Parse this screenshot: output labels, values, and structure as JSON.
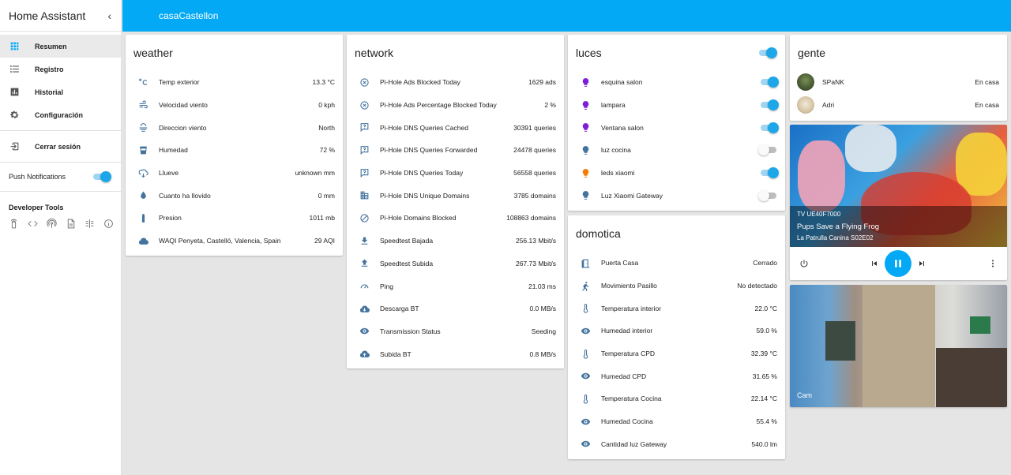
{
  "sidebar": {
    "title": "Home Assistant",
    "items": [
      {
        "label": "Resumen",
        "icon": "apps-icon"
      },
      {
        "label": "Registro",
        "icon": "list-icon"
      },
      {
        "label": "Historial",
        "icon": "chart-icon"
      },
      {
        "label": "Configuración",
        "icon": "gear-icon"
      }
    ],
    "logout": "Cerrar sesión",
    "push": "Push Notifications",
    "dev_tools": "Developer Tools"
  },
  "header": {
    "title": "casaCastellon"
  },
  "weather": {
    "title": "weather",
    "rows": [
      {
        "name": "Temp exterior",
        "value": "13.3 °C"
      },
      {
        "name": "Velocidad viento",
        "value": "0 kph"
      },
      {
        "name": "Direccion viento",
        "value": "North"
      },
      {
        "name": "Humedad",
        "value": "72 %"
      },
      {
        "name": "Llueve",
        "value": "unknown mm"
      },
      {
        "name": "Cuanto ha llovido",
        "value": "0 mm"
      },
      {
        "name": "Presion",
        "value": "1011 mb"
      },
      {
        "name": "WAQI Penyeta, Castelló, Valencia, Spain",
        "value": "29 AQI"
      }
    ]
  },
  "network": {
    "title": "network",
    "rows": [
      {
        "name": "Pi-Hole Ads Blocked Today",
        "value": "1629 ads"
      },
      {
        "name": "Pi-Hole Ads Percentage Blocked Today",
        "value": "2 %"
      },
      {
        "name": "Pi-Hole DNS Queries Cached",
        "value": "30391 queries"
      },
      {
        "name": "Pi-Hole DNS Queries Forwarded",
        "value": "24478 queries"
      },
      {
        "name": "Pi-Hole DNS Queries Today",
        "value": "56558 queries"
      },
      {
        "name": "Pi-Hole DNS Unique Domains",
        "value": "3785 domains"
      },
      {
        "name": "Pi-Hole Domains Blocked",
        "value": "108863 domains"
      },
      {
        "name": "Speedtest Bajada",
        "value": "256.13 Mbit/s"
      },
      {
        "name": "Speedtest Subida",
        "value": "267.73 Mbit/s"
      },
      {
        "name": "Ping",
        "value": "21.03 ms"
      },
      {
        "name": "Descarga BT",
        "value": "0.0 MB/s"
      },
      {
        "name": "Transmission Status",
        "value": "Seeding"
      },
      {
        "name": "Subida BT",
        "value": "0.8 MB/s"
      }
    ]
  },
  "luces": {
    "title": "luces",
    "rows": [
      {
        "name": "esquina salon",
        "on": true,
        "color": "#7c1fd6"
      },
      {
        "name": "lampara",
        "on": true,
        "color": "#7c1fd6"
      },
      {
        "name": "Ventana salon",
        "on": true,
        "color": "#7c1fd6"
      },
      {
        "name": "luz cocina",
        "on": false,
        "color": "#44739e"
      },
      {
        "name": "leds xiaomi",
        "on": true,
        "color": "#f57c00"
      },
      {
        "name": "Luz Xiaomi Gateway",
        "on": false,
        "color": "#44739e"
      }
    ]
  },
  "domotica": {
    "title": "domotica",
    "rows": [
      {
        "name": "Puerta Casa",
        "value": "Cerrado"
      },
      {
        "name": "Movimiento Pasillo",
        "value": "No detectado"
      },
      {
        "name": "Temperatura interior",
        "value": "22.0 °C"
      },
      {
        "name": "Humedad interior",
        "value": "59.0 %"
      },
      {
        "name": "Temperatura CPD",
        "value": "32.39 °C"
      },
      {
        "name": "Humedad CPD",
        "value": "31.65 %"
      },
      {
        "name": "Temperatura Cocina",
        "value": "22.14 °C"
      },
      {
        "name": "Humedad Cocina",
        "value": "55.4 %"
      },
      {
        "name": "Cantidad luz Gateway",
        "value": "540.0 lm"
      }
    ]
  },
  "gente": {
    "title": "gente",
    "rows": [
      {
        "name": "SPaNK",
        "value": "En casa"
      },
      {
        "name": "Adri",
        "value": "En casa"
      }
    ]
  },
  "media": {
    "device": "TV UE40F7000",
    "title": "Pups Save a Flying Frog",
    "subtitle": "La Patrulla Canina S02E02"
  },
  "camera": {
    "label": "Cam"
  },
  "colors": {
    "accent": "#03a9f4",
    "icon": "#44739e"
  }
}
